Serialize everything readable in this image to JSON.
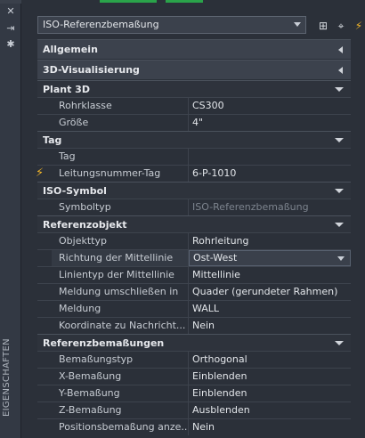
{
  "side_strip": {
    "title": "EIGENSCHAFTEN",
    "icons": [
      "close-icon",
      "pin-icon",
      "settings-icon"
    ]
  },
  "header": {
    "selector_value": "ISO-Referenzbemaßung",
    "buttons": [
      "add-selection-icon",
      "pick-objects-icon",
      "quick-select-icon"
    ]
  },
  "sections": {
    "allgemein": "Allgemein",
    "visual": "3D-Visualisierung",
    "plant": "Plant 3D",
    "tag": "Tag",
    "iso": "ISO-Symbol",
    "ref": "Referenzobjekt",
    "dims": "Referenzbemaßungen"
  },
  "plant": {
    "rohrklasse": {
      "name": "Rohrklasse",
      "value": "CS300"
    },
    "groesse": {
      "name": "Größe",
      "value": "4\""
    }
  },
  "tag": {
    "tag": {
      "name": "Tag",
      "value": ""
    },
    "leitung": {
      "name": "Leitungsnummer-Tag",
      "value": "6-P-1010"
    }
  },
  "iso": {
    "symboltyp": {
      "name": "Symboltyp",
      "value": "ISO-Referenzbemaßung"
    }
  },
  "ref": {
    "objekttyp": {
      "name": "Objekttyp",
      "value": "Rohrleitung"
    },
    "richtung": {
      "name": "Richtung der Mittellinie",
      "value": "Ost-West"
    },
    "linientyp": {
      "name": "Linientyp der Mittellinie",
      "value": "Mittellinie"
    },
    "umschliessen": {
      "name": "Meldung umschließen in",
      "value": "Quader (gerundeter Rahmen)"
    },
    "meldung": {
      "name": "Meldung",
      "value": "WALL"
    },
    "koordinate": {
      "name": "Koordinate zu Nachricht...",
      "value": "Nein"
    }
  },
  "dims": {
    "typ": {
      "name": "Bemaßungstyp",
      "value": "Orthogonal"
    },
    "x": {
      "name": "X-Bemaßung",
      "value": "Einblenden"
    },
    "y": {
      "name": "Y-Bemaßung",
      "value": "Einblenden"
    },
    "z": {
      "name": "Z-Bemaßung",
      "value": "Ausblenden"
    },
    "pos": {
      "name": "Positionsbemaßung anze...",
      "value": "Nein"
    }
  },
  "colors": {
    "background": "#2b3039",
    "accent": "#2aa34a",
    "bolt": "#f0b429"
  }
}
